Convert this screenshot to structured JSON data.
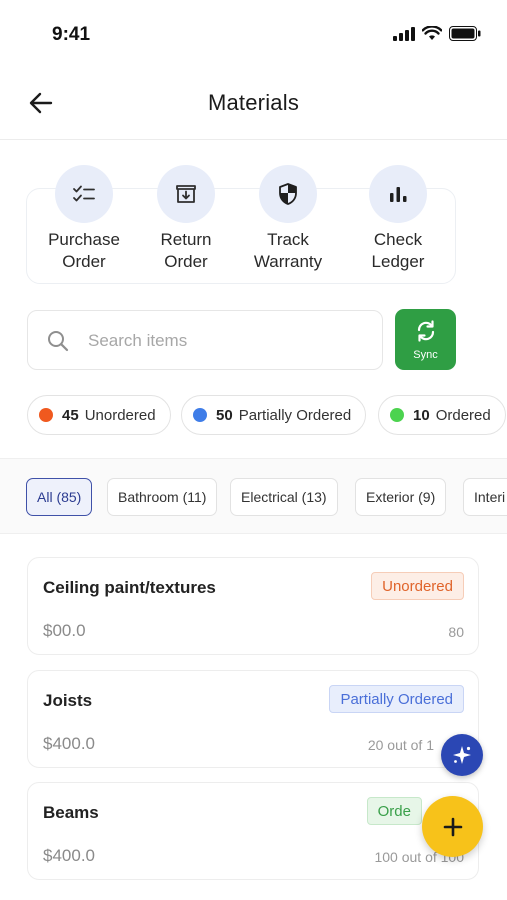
{
  "status_bar": {
    "time": "9:41"
  },
  "header": {
    "title": "Materials"
  },
  "actions": [
    {
      "label": "Purchase\nOrder",
      "icon": "checklist-icon"
    },
    {
      "label": "Return\nOrder",
      "icon": "return-box-icon"
    },
    {
      "label": "Track\nWarranty",
      "icon": "shield-icon"
    },
    {
      "label": "Check\nLedger",
      "icon": "bar-chart-icon"
    }
  ],
  "search": {
    "placeholder": "Search items"
  },
  "sync": {
    "label": "Sync"
  },
  "status_summary": [
    {
      "count": "45",
      "label": "Unordered",
      "color": "#f0591f"
    },
    {
      "count": "50",
      "label": "Partially Ordered",
      "color": "#3f7de8"
    },
    {
      "count": "10",
      "label": "Ordered",
      "color": "#4cd34f"
    }
  ],
  "filters": [
    {
      "label": "All (85)",
      "active": true
    },
    {
      "label": "Bathroom (11)"
    },
    {
      "label": "Electrical (13)"
    },
    {
      "label": "Exterior (9)"
    },
    {
      "label": "Interi"
    }
  ],
  "items": [
    {
      "name": "Ceiling paint/textures",
      "price": "$00.0",
      "status": "Unordered",
      "qty": "80"
    },
    {
      "name": "Joists",
      "price": "$400.0",
      "status": "Partially Ordered",
      "qty": "20 out of 1"
    },
    {
      "name": "Beams",
      "price": "$400.0",
      "status": "Orde",
      "qty": "100 out of 100"
    }
  ],
  "colors": {
    "accent": "#3f51a8",
    "sync": "#2f9e44",
    "fab": "#f7c21a",
    "assistant": "#2b47b4"
  }
}
